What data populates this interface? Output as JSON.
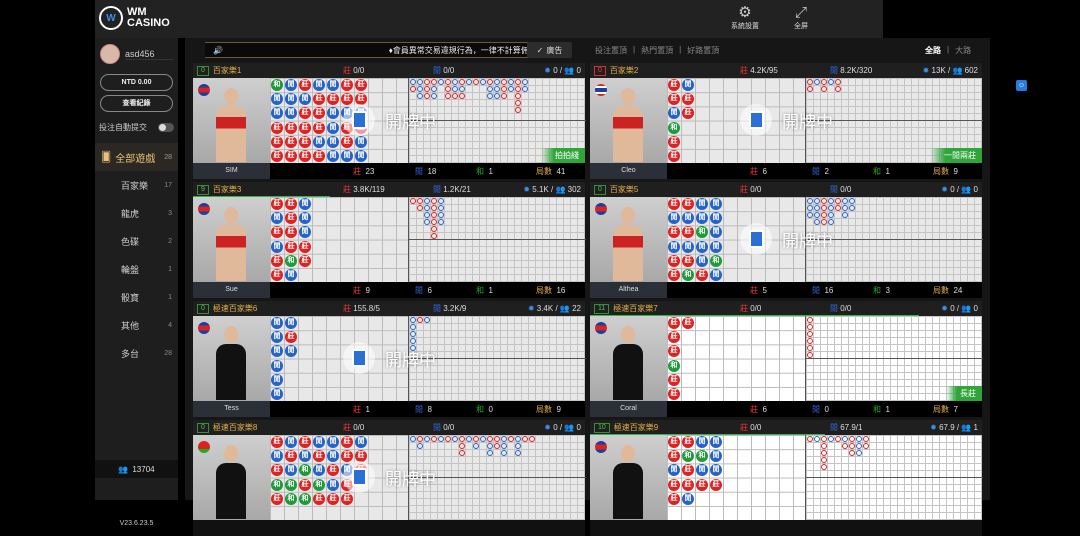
{
  "header": {
    "logo_text_1": "WM",
    "logo_text_2": "CASINO",
    "settings_label": "系統設置",
    "fullscreen_label": "全屏"
  },
  "sidebar": {
    "username": "asd456",
    "balance": "NTD 0.00",
    "records_label": "查看紀錄",
    "auto_submit_label": "投注自動提交",
    "auto_submit_on": false,
    "all_games": {
      "label": "全部遊戲",
      "count": "28"
    },
    "items": [
      {
        "label": "百家樂",
        "count": "17"
      },
      {
        "label": "龍虎",
        "count": "3"
      },
      {
        "label": "色碟",
        "count": "2"
      },
      {
        "label": "輪盤",
        "count": "1"
      },
      {
        "label": "骰寶",
        "count": "1"
      },
      {
        "label": "其他",
        "count": "4"
      },
      {
        "label": "多台",
        "count": "28"
      }
    ],
    "online_count": "13704",
    "version": "V23.6.23.5"
  },
  "marquee": {
    "text": "♦會員異常交易違規行為，一律不計算佣金退:",
    "ad_label": "廣告"
  },
  "filters": [
    "投注置頂",
    "熱門置頂",
    "好路置頂"
  ],
  "views": [
    {
      "label": "全路",
      "active": true
    },
    {
      "label": "大路",
      "active": false
    }
  ],
  "labels": {
    "banker": "莊",
    "player": "閒",
    "tie": "和",
    "rounds": "局數",
    "dealing": "開牌中"
  },
  "colors": {
    "banker": "#dd2222",
    "player": "#2563c9",
    "tie": "#1e9a3a",
    "accent": "#e6b04a",
    "hot": "#2fa53a"
  },
  "tables": [
    {
      "num": "0",
      "num_red": false,
      "name": "百家樂1",
      "banker_bet": "0/0",
      "player_bet": "0/0",
      "chips": "0",
      "players": "0",
      "dealer": "SIM",
      "banker": "23",
      "player": "18",
      "tie": "1",
      "rounds": "41",
      "badge": "拍拍綫",
      "dealing": true,
      "flag": "cambodia",
      "outfit": "#c22",
      "bead": [
        "TPPBBB",
        "PPPBBB",
        "BPBBBB",
        "PBBBPB",
        "PBPPPP",
        "BBPBBP",
        "BBPBPP"
      ],
      "big": [
        "PB",
        "PPP",
        "BBB",
        "BPP",
        "P",
        "BBB",
        "PPB",
        "BPB",
        "P",
        "B",
        "P",
        "BPP",
        "PPP",
        "BBB",
        "PP",
        "BBBBB",
        "PP"
      ],
      "progress": 0
    },
    {
      "num": "0",
      "num_red": true,
      "name": "百家樂2",
      "banker_bet": "4.2K/95",
      "player_bet": "8.2K/320",
      "chips": "13K",
      "players": "602",
      "dealer": "Cleo",
      "banker": "6",
      "player": "2",
      "tie": "1",
      "rounds": "9",
      "badge": "一閒兩莊",
      "dealing": true,
      "flag": "thailand",
      "outfit": "#c22",
      "bead": [
        "BBPTBB",
        "PBB"
      ],
      "big": [
        "BB",
        "P",
        "BB",
        "P",
        "BB"
      ],
      "progress": 0
    },
    {
      "num": "9",
      "num_red": false,
      "name": "百家樂3",
      "banker_bet": "3.8K/119",
      "player_bet": "1.2K/21",
      "chips": "5.1K",
      "players": "302",
      "dealer": "Sue",
      "banker": "9",
      "player": "6",
      "tie": "1",
      "rounds": "16",
      "badge": "",
      "dealing": false,
      "flag": "cambodia",
      "outfit": "#c22",
      "bead": [
        "BPBPBB",
        "BBBBTP",
        "PPPBB"
      ],
      "big": [
        "B",
        "BB",
        "PPPP",
        "BBBBBB",
        "PPPP"
      ],
      "progress": 0.35
    },
    {
      "num": "0",
      "num_red": false,
      "name": "百家樂5",
      "banker_bet": "0/0",
      "player_bet": "0/0",
      "chips": "0",
      "players": "0",
      "dealer": "Althea",
      "banker": "5",
      "player": "16",
      "tie": "3",
      "rounds": "24",
      "badge": "",
      "dealing": true,
      "flag": "cambodia",
      "outfit": "#c22",
      "bead": [
        "BPBPBB",
        "BPBPBT",
        "PPTPPB",
        "PPPPTP"
      ],
      "big": [
        "PPP",
        "PPPP",
        "BBBB",
        "PPPP",
        "BB",
        "PPP",
        "PP"
      ],
      "progress": 0
    },
    {
      "num": "0",
      "num_red": false,
      "name": "極速百家樂6",
      "banker_bet": "155.8/5",
      "player_bet": "3.2K/9",
      "chips": "3.4K",
      "players": "22",
      "dealer": "Tess",
      "banker": "1",
      "player": "8",
      "tie": "0",
      "rounds": "9",
      "badge": "",
      "dealing": true,
      "flag": "cambodia",
      "outfit": "#111",
      "bead": [
        "PPPPPP",
        "PBP"
      ],
      "big": [
        "PPPPP",
        "B",
        "P"
      ],
      "progress": 0
    },
    {
      "num": "11",
      "num_red": false,
      "name": "極速百家樂7",
      "banker_bet": "0/0",
      "player_bet": "0/0",
      "chips": "0",
      "players": "0",
      "dealer": "Coral",
      "banker": "6",
      "player": "0",
      "tie": "1",
      "rounds": "7",
      "badge": "長莊",
      "dealing": false,
      "flag": "cambodia",
      "outfit": "#111",
      "bead": [
        "BBBTBB",
        "B"
      ],
      "big": [
        "BBBBBB"
      ],
      "progress": 0.84,
      "white": true
    },
    {
      "num": "0",
      "num_red": false,
      "name": "極速百家樂8",
      "banker_bet": "0/0",
      "player_bet": "0/0",
      "chips": "0",
      "players": "0",
      "dealer": "",
      "banker": "",
      "player": "",
      "tie": "",
      "rounds": "",
      "badge": "",
      "dealing": true,
      "flag": "belarus",
      "outfit": "#111",
      "bead": [
        "BPBTB",
        "PBPTT",
        "BPTBT",
        "PBPTB",
        "PPBPB",
        "BBPBB",
        "PBB"
      ],
      "big": [
        "P",
        "BP",
        "P",
        "B",
        "P",
        "B",
        "P",
        "BBB",
        "P",
        "BP",
        "P",
        "BPP",
        "BB",
        "PPP",
        "B",
        "PPP",
        "B",
        "B"
      ],
      "progress": 0
    },
    {
      "num": "10",
      "num_red": false,
      "name": "極速百家樂9",
      "banker_bet": "0/0",
      "player_bet": "67.9/1",
      "chips": "67.9",
      "players": "1",
      "dealer": "",
      "banker": "",
      "player": "",
      "tie": "",
      "rounds": "",
      "badge": "",
      "dealing": false,
      "flag": "cambodia",
      "outfit": "#111",
      "bead": [
        "BBPBB",
        "BTBBP",
        "PTPB",
        "PPPB"
      ],
      "big": [
        "B",
        "P",
        "BBBBB",
        "P",
        "B",
        "PB",
        "BBB",
        "PPP",
        "BB"
      ],
      "progress": 0.6,
      "white": true
    }
  ]
}
